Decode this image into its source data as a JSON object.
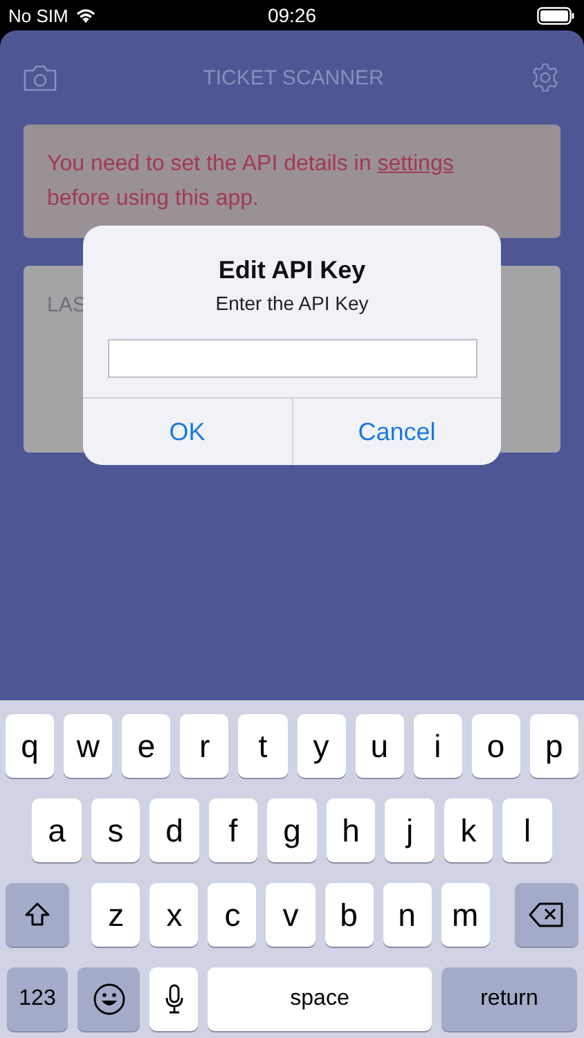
{
  "status_bar": {
    "carrier": "No SIM",
    "time": "09:26"
  },
  "header": {
    "title": "TICKET SCANNER"
  },
  "banner": {
    "text": "You need to set the API details in ",
    "link": "settings",
    "text_after": "before using this app."
  },
  "card": {
    "label": "LAS"
  },
  "dialog": {
    "title": "Edit API Key",
    "message": "Enter the API Key",
    "buttons": [
      {
        "label": "OK"
      },
      {
        "label": "Cancel"
      }
    ]
  },
  "keyboard": {
    "letter_row": [
      {
        "kind": "letter",
        "label": "q"
      },
      {
        "kind": "letter",
        "label": "w"
      },
      {
        "kind": "letter",
        "label": "e"
      },
      {
        "kind": "letter",
        "label": "r"
      },
      {
        "kind": "letter",
        "label": "t"
      },
      {
        "kind": "letter",
        "label": "y"
      },
      {
        "kind": "letter",
        "label": "u"
      },
      {
        "kind": "letter",
        "label": "i"
      },
      {
        "kind": "letter",
        "label": "o"
      },
      {
        "kind": "letter",
        "label": "p"
      }
    ],
    "home_row": [
      {
        "kind": "letter",
        "label": "a"
      },
      {
        "kind": "letter",
        "label": "s"
      },
      {
        "kind": "letter",
        "label": "d"
      },
      {
        "kind": "letter",
        "label": "f"
      },
      {
        "kind": "letter",
        "label": "g"
      },
      {
        "kind": "letter",
        "label": "h"
      },
      {
        "kind": "letter",
        "label": "j"
      },
      {
        "kind": "letter",
        "label": "k"
      },
      {
        "kind": "letter",
        "label": "l"
      }
    ],
    "shift_row": [
      {
        "kind": "shift"
      },
      {
        "kind": "letter",
        "label": "z"
      },
      {
        "kind": "letter",
        "label": "x"
      },
      {
        "kind": "letter",
        "label": "c"
      },
      {
        "kind": "letter",
        "label": "v"
      },
      {
        "kind": "letter",
        "label": "b"
      },
      {
        "kind": "letter",
        "label": "n"
      },
      {
        "kind": "letter",
        "label": "m"
      },
      {
        "kind": "delete"
      }
    ],
    "bottom_row": [
      {
        "kind": "numbers",
        "label": "123"
      },
      {
        "kind": "emoji"
      },
      {
        "kind": "mic"
      },
      {
        "kind": "space",
        "label": "space"
      },
      {
        "kind": "return",
        "label": "return"
      }
    ]
  }
}
